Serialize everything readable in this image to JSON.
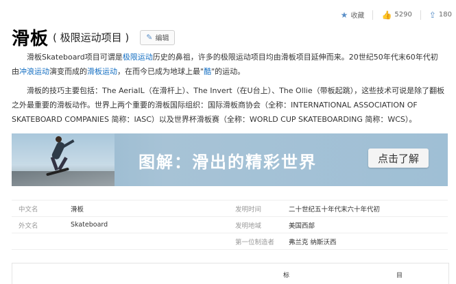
{
  "topbar": {
    "favorite_label": "收藏",
    "favorite_icon": "star-icon",
    "like_count": "5290",
    "like_icon": "thumbs-up-icon",
    "share_count": "180",
    "share_icon": "share-icon"
  },
  "header": {
    "title": "滑板",
    "subtitle": "( 极限运动项目 )",
    "edit_label": "编辑",
    "edit_icon": "pencil-icon"
  },
  "intro": {
    "p1_a": "滑板Skateboard项目可谓是",
    "p1_link1": "极限运动",
    "p1_b": "历史的鼻祖，许多的极限运动项目均由滑板项目延伸而来。20世纪50年代末60年代初由",
    "p1_link2": "冲浪运动",
    "p1_c": "演变而成的",
    "p1_link3": "滑板运动",
    "p1_d": "，在而今已成为地球上最\"",
    "p1_link4": "酷",
    "p1_e": "\"的运动。",
    "p2": "滑板的技巧主要包括：The AeriaIL（在滑杆上）、The Invert（在U台上）、The Ollie（带板起跳），这些技术可说是除了翻板之外最重要的滑板动作。世界上两个重要的滑板国际组织：国际滑板商协会（全称：INTERNATIONAL ASSOCIATION OF SKATEBOARD COMPANIES 简称：IASC）以及世界杯滑板赛（全称：WORLD CUP SKATEBOARDING 简称：WCS）。"
  },
  "banner": {
    "title": "图解：滑出的精彩世界",
    "button_label": "点击了解"
  },
  "infobox": {
    "rows": [
      {
        "k": "中文名",
        "v": "滑板",
        "k2": "发明时间",
        "v2": "二十世纪五十年代末六十年代初"
      },
      {
        "k": "外文名",
        "v": "Skateboard",
        "k2": "发明地域",
        "v2": "美国西部"
      },
      {
        "k": "",
        "v": "",
        "k2": "第一位制造者",
        "v2": "弗兰克 纳斯沃西"
      }
    ]
  },
  "bottom": {
    "frag1": "标",
    "frag2": "目"
  },
  "colors": {
    "link": "#136ec2",
    "accent": "#5a8fc8"
  }
}
